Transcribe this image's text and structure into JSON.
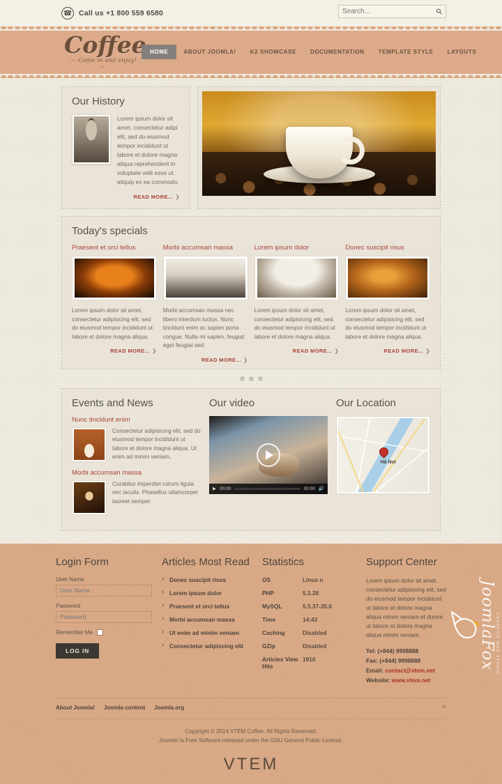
{
  "topbar": {
    "phone_icon": "phone-icon",
    "call_text": "Call us +1 800 559 6580",
    "search_placeholder": "Search...",
    "search_value": "",
    "search_icon": "search-icon"
  },
  "header": {
    "brand": "Coffee",
    "slogan": "Come in and enjoy!",
    "nav": [
      {
        "label": "HOME",
        "active": true
      },
      {
        "label": "ABOUT JOOMLA!",
        "active": false
      },
      {
        "label": "K2 SHOWCASE",
        "active": false
      },
      {
        "label": "DOCUMENTATION",
        "active": false
      },
      {
        "label": "TEMPLATE STYLE",
        "active": false
      },
      {
        "label": "LAYOUTS",
        "active": false
      }
    ]
  },
  "history": {
    "title": "Our History",
    "text": "Lorem ipsum dolor sit amet, consectetur adipi elit, sed do eiusmod tempor incididunt ut labore et dolore magna aliqua reprehenderit in voluptate velit esse ut aliquip ex ea commodo.",
    "read_more": "READ MORE...",
    "photo_alt": "portrait-photo"
  },
  "hero": {
    "alt": "coffee-cup-and-beans-photo"
  },
  "specials": {
    "title": "Today's specials",
    "read_more": "READ MORE...",
    "cards": [
      {
        "title": "Praesent et orci tellus",
        "text": "Lorem ipsum dolor sit amet, consectetur adipisicing elit, sed do eiusmod tempor incididunt ut labore et dolore magna aliqua.",
        "image": "cappuccino-photo"
      },
      {
        "title": "Morbi accumsan massa",
        "text": "Morbi accumsan massa nec libero interdum luctus. Nunc tincidunt enim ac sapien porta congue. Nulla mi sapien, feugiat eget feugiat sed.",
        "image": "french-press-photo"
      },
      {
        "title": "Lorem ipsum dolor",
        "text": "Lorem ipsum dolor sit amet, consectetur adipisicing elit, sed do eiusmod tempor incididunt ut labore et dolore magna aliqua.",
        "image": "frappe-photo"
      },
      {
        "title": "Donec suscipit risus",
        "text": "Lorem ipsum dolor sit amet, consectetur adipisicing elit, sed do eiusmod tempor incididunt ut labore et dolore magna aliqua.",
        "image": "ground-coffee-photo"
      }
    ],
    "dots": 3,
    "active_dot": 1
  },
  "news": {
    "title": "Events and News",
    "items": [
      {
        "title": "Nunc tincidunt enim",
        "text": "Consectetur adipisicing elit, sed do eiusmod tempor incididunt ut labore et dolore magna aliqua. Ut enim ad minim veniam,",
        "thumb": "heart-steam-cup-thumb"
      },
      {
        "title": "Morbi accumsan massa",
        "text": "Curabitur imperdiet rutrum ligula nec iaculis. Phasellus ullamcorper laoreet semper.",
        "thumb": "coffee-beans-cup-thumb"
      }
    ]
  },
  "video": {
    "title": "Our video",
    "play_icon": "play-icon",
    "time_current": "00:00",
    "time_total": "00:00",
    "volume_icon": "volume-icon",
    "poster_alt": "latte-art-pouring-video"
  },
  "map": {
    "title": "Our Location",
    "city_label": "Hà Noi",
    "pin_icon": "map-pin-icon",
    "alt": "hanoi-map"
  },
  "footer": {
    "login": {
      "title": "Login Form",
      "username_label": "User Name",
      "username_placeholder": "User Name",
      "username_value": "",
      "password_label": "Password",
      "password_placeholder": "Password",
      "password_value": "",
      "remember_label": "Remember Me",
      "remember_checked": false,
      "button": "LOG IN"
    },
    "articles": {
      "title": "Articles Most Read",
      "items": [
        "Donec suscipit risus",
        "Lorem ipsum dolor",
        "Praesent et orci tellus",
        "Morbi accumsan massa",
        "Ut enim ad minim veniam",
        "Consectetur adipiscing elit"
      ]
    },
    "statistics": {
      "title": "Statistics",
      "rows": [
        {
          "key": "OS",
          "value": "Linux n"
        },
        {
          "key": "PHP",
          "value": "5.3.28"
        },
        {
          "key": "MySQL",
          "value": "5.5.37-35.0"
        },
        {
          "key": "Time",
          "value": "14:43"
        },
        {
          "key": "Caching",
          "value": "Disabled"
        },
        {
          "key": "GZip",
          "value": "Disabled"
        },
        {
          "key": "Articles View Hits",
          "value": "1916"
        }
      ]
    },
    "support": {
      "title": "Support Center",
      "text": "Lorem ipsum dolor sit amet, consectetur adipisicing elit, sed do eiusmod tempor incididunt ut labore et dolore magna aliqua minim veniam et dolore ut labore et dolore magna aliqua minim veniam.",
      "tel_label": "Tel: (+844) 9998888",
      "fax_label": "Fax: (+844) 9998888",
      "email_label": "Email:",
      "email_value": "contact@vtem.net",
      "website_label": "Website:",
      "website_value": "www.vtem.net"
    },
    "watermark": {
      "name": "JoomlaFox",
      "sub": "CREATIVE WEB STUDIO"
    },
    "bottom_links": [
      "About Joomla!",
      "Joomla content",
      "Joomla.org"
    ],
    "to_top_icon": "chevron-up-icon",
    "copyright_line1": "Copyright © 2014 VTEM Coffee. All Rights Reserved.",
    "copyright_line2": "Joomla! is Free Software released under the GNU General Public License.",
    "vtem_logo": "VTEM"
  },
  "colors": {
    "accent_red": "#a8423a",
    "header_tan": "#dda988",
    "footer_tan": "#d9a884",
    "canvas": "#efeadd",
    "panel": "#eae4d8"
  }
}
